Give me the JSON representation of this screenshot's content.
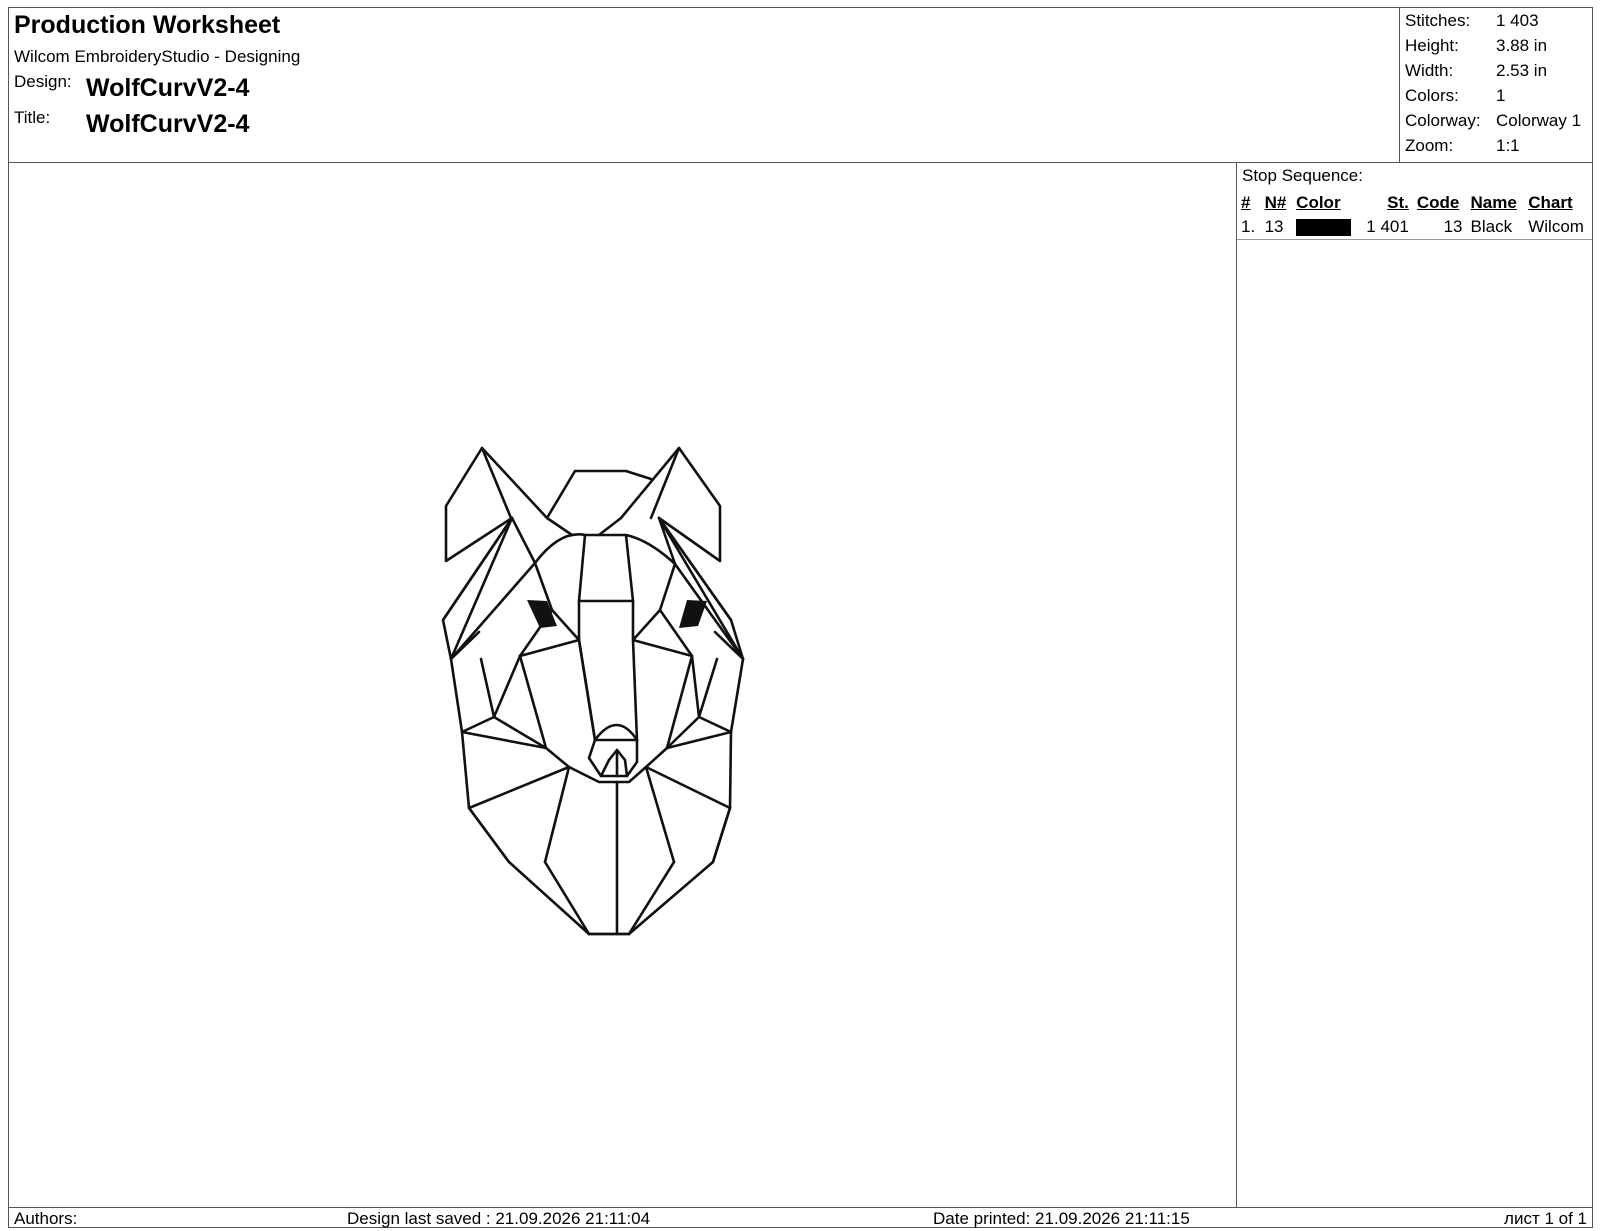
{
  "header": {
    "title": "Production Worksheet",
    "app_name": "Wilcom EmbroideryStudio - Designing",
    "design_label": "Design:",
    "design_value": "WolfCurvV2-4",
    "title_label": "Title:",
    "title_value": "WolfCurvV2-4"
  },
  "stats": [
    {
      "label": "Stitches:",
      "value": "1 403"
    },
    {
      "label": "Height:",
      "value": "3.88 in"
    },
    {
      "label": "Width:",
      "value": "2.53 in"
    },
    {
      "label": "Colors:",
      "value": "1"
    },
    {
      "label": "Colorway:",
      "value": "Colorway 1"
    },
    {
      "label": "Zoom:",
      "value": "1:1"
    }
  ],
  "stop_sequence": {
    "title": "Stop Sequence:",
    "headers": {
      "index": "#",
      "needle": "N#",
      "color": "Color",
      "stitches": "St.",
      "code": "Code",
      "name": "Name",
      "chart": "Chart"
    },
    "rows": [
      {
        "index": "1.",
        "needle": "13",
        "color_hex": "#000000",
        "stitches": "1 401",
        "code": "13",
        "name": "Black",
        "chart": "Wilcom"
      }
    ]
  },
  "design": {
    "description_icon": "wolf-head-embroidery",
    "thread_color": "#111111"
  },
  "footer": {
    "authors": "Authors:",
    "last_saved": "Design last saved : 21.09.2026 21:11:04",
    "date_printed": "Date printed: 21.09.2026 21:11:15",
    "page": "лист 1 of 1"
  }
}
